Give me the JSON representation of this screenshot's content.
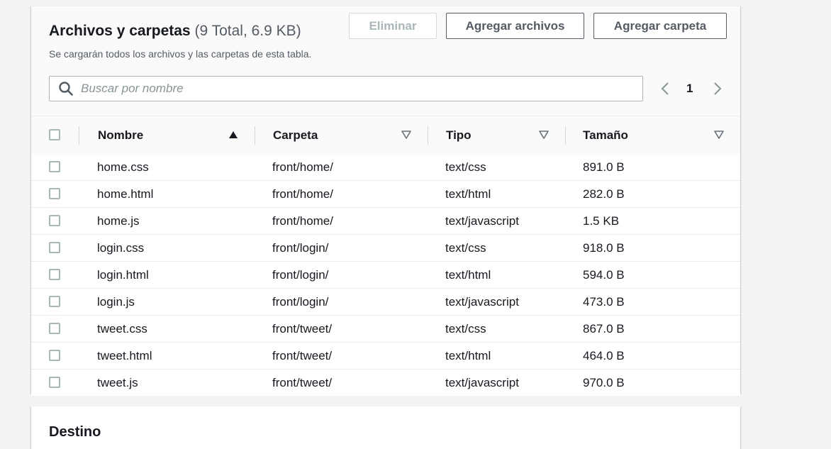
{
  "files_panel": {
    "title": "Archivos y carpetas",
    "counter": "(9 Total, 6.9 KB)",
    "subtitle": "Se cargarán todos los archivos y las carpetas de esta tabla.",
    "buttons": {
      "delete": "Eliminar",
      "add_files": "Agregar archivos",
      "add_folder": "Agregar carpeta"
    },
    "search": {
      "placeholder": "Buscar por nombre"
    },
    "pagination": {
      "current_page": "1"
    },
    "columns": {
      "name": "Nombre",
      "folder": "Carpeta",
      "type": "Tipo",
      "size": "Tamaño"
    },
    "sort": {
      "column": "name",
      "direction": "ascending"
    },
    "rows": [
      {
        "name": "home.css",
        "folder": "front/home/",
        "type": "text/css",
        "size": "891.0 B"
      },
      {
        "name": "home.html",
        "folder": "front/home/",
        "type": "text/html",
        "size": "282.0 B"
      },
      {
        "name": "home.js",
        "folder": "front/home/",
        "type": "text/javascript",
        "size": "1.5 KB"
      },
      {
        "name": "login.css",
        "folder": "front/login/",
        "type": "text/css",
        "size": "918.0 B"
      },
      {
        "name": "login.html",
        "folder": "front/login/",
        "type": "text/html",
        "size": "594.0 B"
      },
      {
        "name": "login.js",
        "folder": "front/login/",
        "type": "text/javascript",
        "size": "473.0 B"
      },
      {
        "name": "tweet.css",
        "folder": "front/tweet/",
        "type": "text/css",
        "size": "867.0 B"
      },
      {
        "name": "tweet.html",
        "folder": "front/tweet/",
        "type": "text/html",
        "size": "464.0 B"
      },
      {
        "name": "tweet.js",
        "folder": "front/tweet/",
        "type": "text/javascript",
        "size": "970.0 B"
      }
    ]
  },
  "destination_panel": {
    "title": "Destino"
  },
  "icons": {
    "search": "search-icon",
    "prev": "chevron-left-icon",
    "next": "chevron-right-icon",
    "sort_asc": "sort-ascending-icon",
    "sort_none": "sort-descending-icon"
  },
  "colors": {
    "page_background": "#f2f3f3",
    "panel_background": "#fafafa",
    "text_primary": "#16191f",
    "text_secondary": "#545b64",
    "disabled": "#aab7b8"
  }
}
